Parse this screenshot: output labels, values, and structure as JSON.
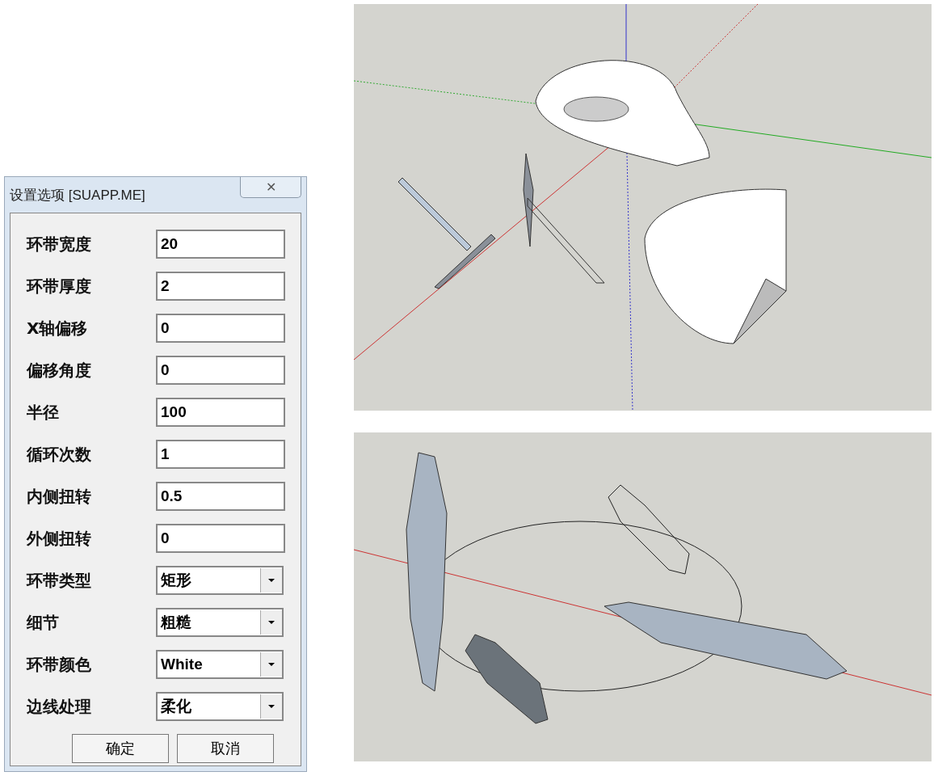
{
  "dialog": {
    "title": "设置选项 [SUAPP.ME]",
    "close_icon": "✕",
    "fields": [
      {
        "label": "环带宽度",
        "value": "20",
        "kind": "text"
      },
      {
        "label": "环带厚度",
        "value": "2",
        "kind": "text"
      },
      {
        "label": "X轴偏移",
        "value": "0",
        "kind": "text"
      },
      {
        "label": "偏移角度",
        "value": "0",
        "kind": "text"
      },
      {
        "label": "半径",
        "value": "100",
        "kind": "text"
      },
      {
        "label": "循环次数",
        "value": "1",
        "kind": "text"
      },
      {
        "label": "内侧扭转",
        "value": "0.5",
        "kind": "text"
      },
      {
        "label": "外侧扭转",
        "value": "0",
        "kind": "text"
      },
      {
        "label": "环带类型",
        "value": "矩形",
        "kind": "select"
      },
      {
        "label": "细节",
        "value": "粗糙",
        "kind": "select"
      },
      {
        "label": "环带颜色",
        "value": "White",
        "kind": "select"
      },
      {
        "label": "边线处理",
        "value": "柔化",
        "kind": "select"
      }
    ],
    "buttons": [
      "确定",
      "取消"
    ]
  }
}
